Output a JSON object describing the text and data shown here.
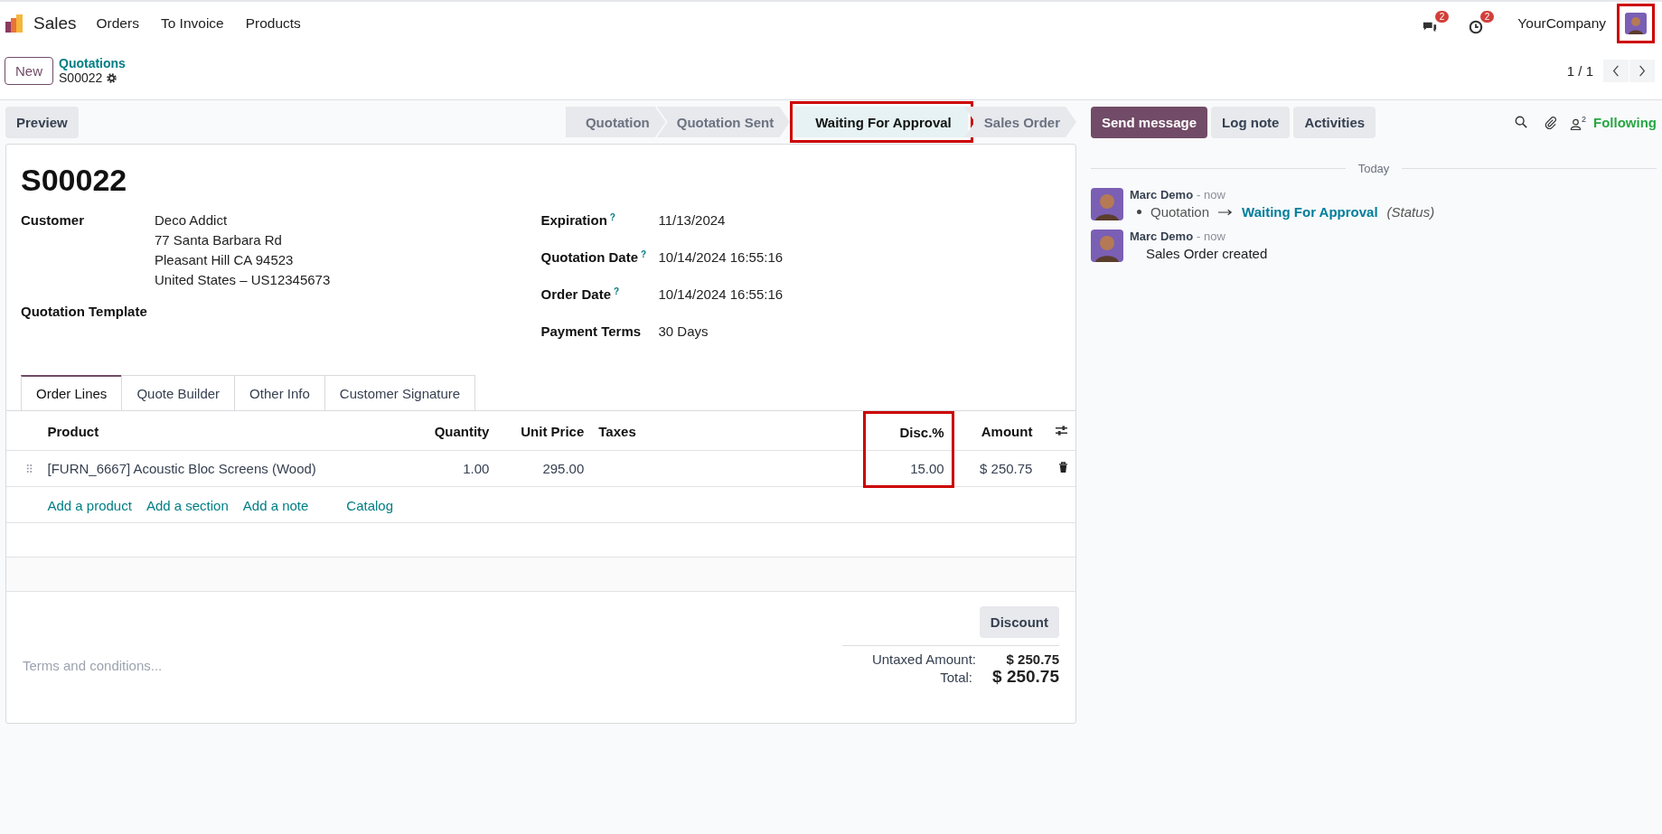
{
  "navbar": {
    "app_name": "Sales",
    "menu": [
      "Orders",
      "To Invoice",
      "Products"
    ],
    "messages_badge": "2",
    "activities_badge": "2",
    "company": "YourCompany",
    "avatar_highlighted": true
  },
  "control": {
    "new_button": "New",
    "breadcrumb": "Quotations",
    "record": "S00022",
    "pager": "1 / 1"
  },
  "preview_button": "Preview",
  "status_steps": [
    {
      "label": "Quotation",
      "selected": false,
      "highlighted": false
    },
    {
      "label": "Quotation Sent",
      "selected": false,
      "highlighted": false
    },
    {
      "label": "Waiting For Approval",
      "selected": true,
      "highlighted": true
    },
    {
      "label": "Sales Order",
      "selected": false,
      "highlighted": false
    }
  ],
  "chatter_buttons": [
    {
      "label": "Send message",
      "kind": "primary"
    },
    {
      "label": "Log note",
      "kind": "secondary"
    },
    {
      "label": "Activities",
      "kind": "secondary"
    }
  ],
  "followers_count": "2",
  "following": "Following",
  "form": {
    "title": "S00022",
    "left_fields": [
      {
        "label": "Customer",
        "lines": [
          "Deco Addict",
          "77 Santa Barbara Rd",
          "Pleasant Hill CA 94523",
          "United States – US12345673"
        ]
      },
      {
        "label": "Quotation Template"
      }
    ],
    "right_fields": [
      {
        "label": "Expiration",
        "help": "?",
        "value": "11/13/2024"
      },
      {
        "label": "Quotation Date",
        "help": "?",
        "value": "10/14/2024 16:55:16"
      },
      {
        "label": "Order Date",
        "help": "?",
        "value": "10/14/2024 16:55:16"
      },
      {
        "label": "Payment Terms",
        "value": "30 Days"
      }
    ],
    "tabs": [
      {
        "label": "Order Lines",
        "selected": true
      },
      {
        "label": "Quote Builder",
        "selected": false
      },
      {
        "label": "Other Info",
        "selected": false
      },
      {
        "label": "Customer Signature",
        "selected": false
      }
    ],
    "columns": [
      {
        "label": "Product",
        "highlighted": false
      },
      {
        "label": "Quantity",
        "highlighted": false
      },
      {
        "label": "Unit Price",
        "highlighted": false
      },
      {
        "label": "Taxes",
        "highlighted": false
      },
      {
        "label": "Disc.%",
        "highlighted": true
      },
      {
        "label": "Amount",
        "highlighted": false
      }
    ],
    "rows": [
      {
        "cells": [
          "[FURN_6667] Acoustic Bloc Screens (Wood)",
          "1.00",
          "295.00",
          "",
          "15.00",
          "$ 250.75"
        ]
      }
    ],
    "add_links": [
      "Add a product",
      "Add a section",
      "Add a note",
      "Catalog"
    ],
    "terms_placeholder": "Terms and conditions...",
    "discount_button": "Discount",
    "totals": [
      {
        "label": "Untaxed Amount:",
        "value": "$ 250.75",
        "kind": "subtotal"
      },
      {
        "label": "Total:",
        "value": "$ 250.75",
        "kind": "total"
      }
    ]
  },
  "chatter": {
    "date": "Today",
    "messages": [
      {
        "author": "Marc Demo",
        "time": "- now",
        "kind": "tracking",
        "old": "Quotation",
        "new": "Waiting For Approval",
        "field": "(Status)"
      },
      {
        "author": "Marc Demo",
        "time": "- now",
        "kind": "text",
        "body": "Sales Order created"
      }
    ]
  }
}
